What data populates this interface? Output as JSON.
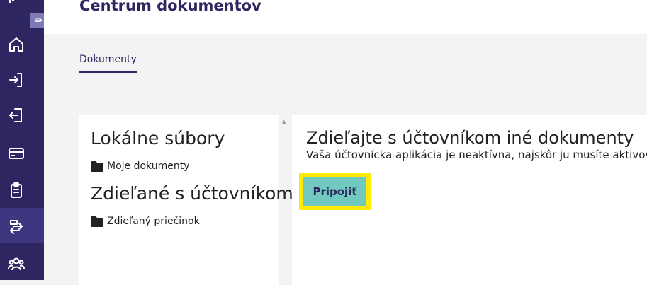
{
  "header": {
    "title": "Centrum dokumentov"
  },
  "tabs": [
    {
      "label": "Dokumenty"
    }
  ],
  "left_panel": {
    "local_heading": "Lokálne súbory",
    "local_folder": "Moje dokumenty",
    "shared_heading": "Zdieľané s účtovníkom",
    "shared_folder": "Zdieľaný priečinok"
  },
  "right_panel": {
    "title": "Zdieľajte s účtovníkom iné dokumenty",
    "subtitle": "Vaša účtovnícka aplikácia je neaktívna, najskôr ju musíte aktivovať",
    "connect_label": "Pripojiť"
  },
  "sidebar": {
    "items": [
      {
        "icon": "home-icon"
      },
      {
        "icon": "incoming-icon"
      },
      {
        "icon": "outgoing-icon"
      },
      {
        "icon": "card-icon"
      },
      {
        "icon": "clipboard-icon"
      },
      {
        "icon": "exchange-icon",
        "active": true
      },
      {
        "icon": "users-icon"
      }
    ]
  },
  "colors": {
    "sidebar": "#2d2660",
    "sidebar_active": "#3e3780",
    "accent": "#71c9c0",
    "highlight": "#ffeb00"
  }
}
